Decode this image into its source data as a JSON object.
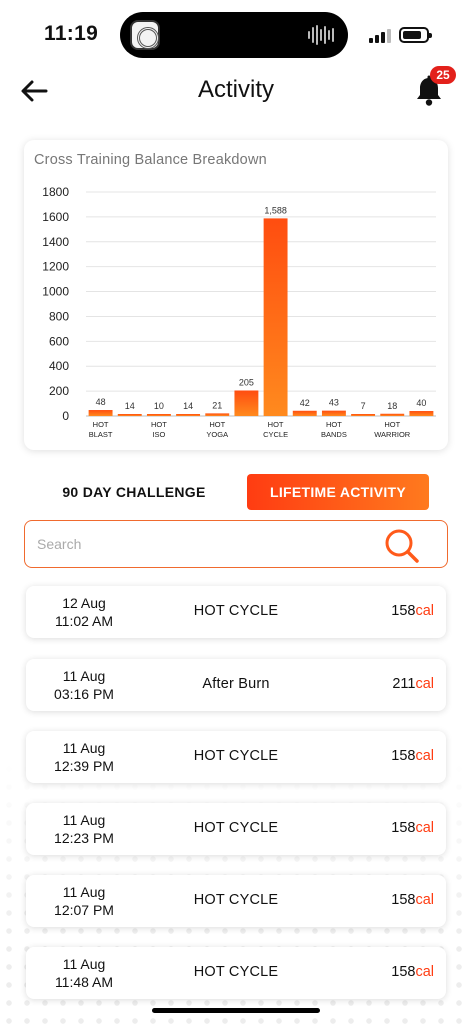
{
  "status_bar": {
    "time": "11:19"
  },
  "header": {
    "title": "Activity",
    "notification_count": "25"
  },
  "chart_data": {
    "type": "bar",
    "title": "Cross Training Balance Breakdown",
    "categories": [
      "HOT BLAST",
      "",
      "HOT ISO",
      "",
      "HOT YOGA",
      "",
      "HOT CYCLE",
      "",
      "HOT BANDS",
      "",
      "HOT WARRIOR",
      ""
    ],
    "category_lines": [
      [
        "HOT",
        "BLAST"
      ],
      [],
      [
        "HOT",
        "ISO"
      ],
      [],
      [
        "HOT",
        "YOGA"
      ],
      [],
      [
        "HOT",
        "CYCLE"
      ],
      [],
      [
        "HOT",
        "BANDS"
      ],
      [],
      [
        "HOT",
        "WARRIOR"
      ],
      []
    ],
    "values": [
      48,
      14,
      10,
      14,
      21,
      205,
      1588,
      42,
      43,
      7,
      18,
      40
    ],
    "value_labels": [
      "48",
      "14",
      "10",
      "14",
      "21",
      "205",
      "1,588",
      "42",
      "43",
      "7",
      "18",
      "40"
    ],
    "ylim": [
      0,
      1800
    ],
    "yticks": [
      "0",
      "200",
      "400",
      "600",
      "800",
      "1000",
      "1200",
      "1400",
      "1600",
      "1800"
    ],
    "grid": true,
    "bar_color_top": "#ff4d10",
    "bar_color_bottom": "#ff8a1e"
  },
  "tabs": {
    "challenge_label": "90 DAY CHALLENGE",
    "lifetime_label": "LIFETIME ACTIVITY",
    "active": "LIFETIME ACTIVITY"
  },
  "search": {
    "placeholder": "Search"
  },
  "activities": [
    {
      "day": "12 Aug",
      "time": "11:02 AM",
      "name": "HOT CYCLE",
      "calories": "158",
      "unit": "cal"
    },
    {
      "day": "11 Aug",
      "time": "03:16 PM",
      "name": "After Burn",
      "calories": "211",
      "unit": "cal"
    },
    {
      "day": "11 Aug",
      "time": "12:39 PM",
      "name": "HOT CYCLE",
      "calories": "158",
      "unit": "cal"
    },
    {
      "day": "11 Aug",
      "time": "12:23 PM",
      "name": "HOT CYCLE",
      "calories": "158",
      "unit": "cal"
    },
    {
      "day": "11 Aug",
      "time": "12:07 PM",
      "name": "HOT CYCLE",
      "calories": "158",
      "unit": "cal"
    },
    {
      "day": "11 Aug",
      "time": "11:48 AM",
      "name": "HOT CYCLE",
      "calories": "158",
      "unit": "cal"
    }
  ],
  "colors": {
    "accent": "#ff3c12",
    "accent_light": "#ff7a1e",
    "badge": "#e3211b"
  },
  "icons": {
    "back": "arrow-left-icon",
    "notifications": "bell-icon",
    "search": "search-icon"
  }
}
